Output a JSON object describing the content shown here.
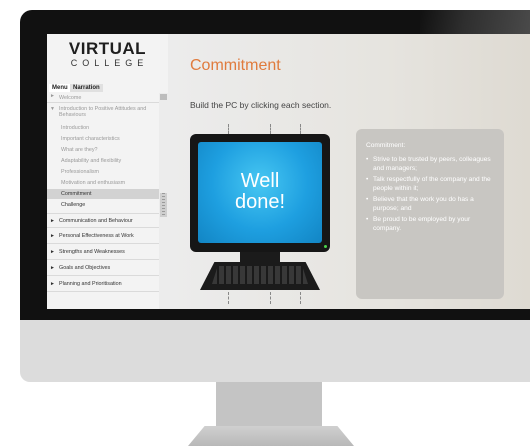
{
  "logo": {
    "top": "VIRTUAL",
    "bottom": "COLLEGE"
  },
  "tabs": {
    "menu": "Menu",
    "narration": "Narration"
  },
  "nav": {
    "welcome": "Welcome",
    "section1": "Introduction to Positive Attitudes and Behaviours",
    "subitems": [
      "Introduction",
      "Important characteristics",
      "What are they?",
      "Adaptability and flexibility",
      "Professionalism",
      "Motivation and enthusiasm",
      "Commitment",
      "Challenge"
    ],
    "sections": [
      "Communication and Behaviour",
      "Personal Effectiveness at Work",
      "Strengths and Weaknesses",
      "Goals and Objectives",
      "Planning and Prioritisation"
    ]
  },
  "content": {
    "title": "Commitment",
    "instruction": "Build the PC by clicking each section.",
    "screen_message_1": "Well",
    "screen_message_2": "done!",
    "panel_heading": "Commitment:",
    "panel_bullets": [
      "Strive to be trusted by peers, colleagues and managers;",
      "Talk respectfully of the company and the people within it;",
      "Believe that the work you do has a purpose; and",
      "Be proud to be employed by your company."
    ]
  },
  "colors": {
    "accent": "#e07b3d",
    "screen_blue": "#1e9fe0",
    "panel": "#c8c6c2"
  }
}
